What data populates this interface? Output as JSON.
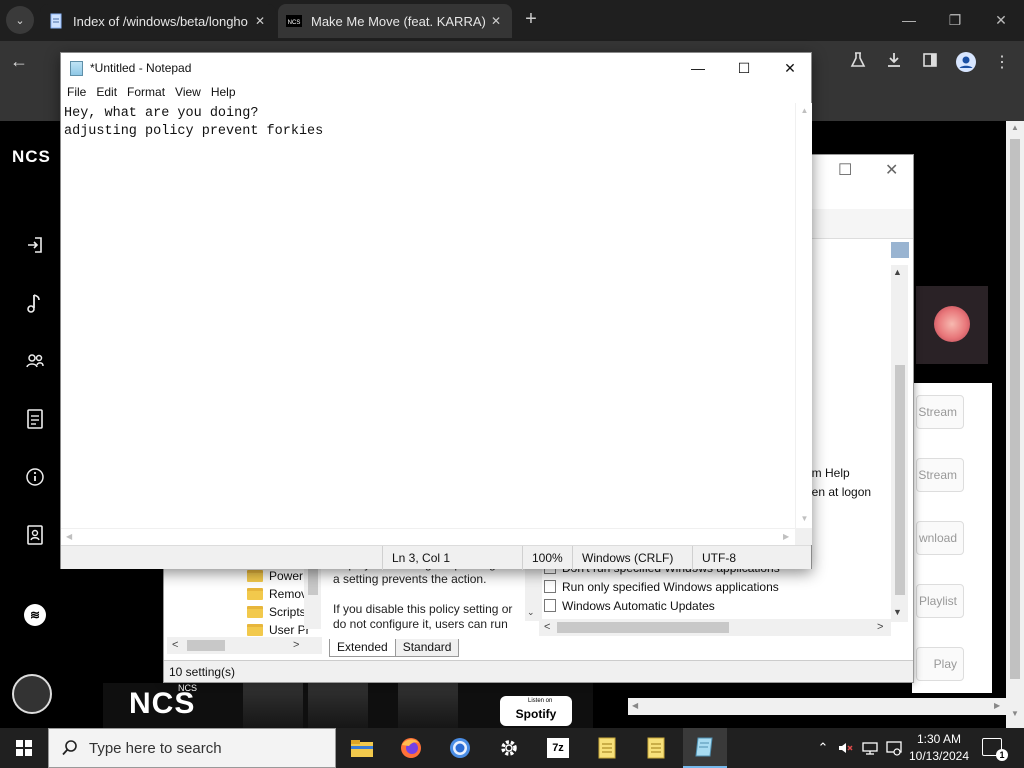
{
  "browser": {
    "tabs": [
      {
        "title": "Index of /windows/beta/longho",
        "close": "✕"
      },
      {
        "title": "Make Me Move (feat. KARRA) [",
        "close": "✕"
      }
    ],
    "new_tab": "+",
    "window_controls": {
      "minimize": "—",
      "maximize": "❐",
      "close": "✕"
    }
  },
  "ncs": {
    "logo": "NCS",
    "banner_text": "NCS",
    "banner_sub": "NCS",
    "spotify_listen": "Listen on",
    "spotify_label": "Spotify",
    "side_buttons": [
      "Stream",
      "Stream",
      "wnload",
      "Playlist",
      "Play"
    ]
  },
  "gpe": {
    "tree_items": [
      "Power",
      "Remov",
      "Scripts",
      "User Pr"
    ],
    "description": "displays a message explaining that a setting prevents the action.\n\nIf you disable this policy setting or do not configure it, users can run",
    "list_items": [
      "Don't run specified Windows applications",
      "Run only specified Windows applications",
      "Windows Automatic Updates"
    ],
    "right_texts": [
      "om Help",
      "een at logon"
    ],
    "tabs": [
      "Extended",
      "Standard"
    ],
    "status": "10 setting(s)"
  },
  "notepad": {
    "title": "*Untitled - Notepad",
    "menu": [
      "File",
      "Edit",
      "Format",
      "View",
      "Help"
    ],
    "content": "Hey, what are you doing?\nadjusting policy prevent forkies",
    "status": {
      "position": "Ln 3, Col 1",
      "zoom": "100%",
      "line_ending": "Windows (CRLF)",
      "encoding": "UTF-8"
    },
    "controls": {
      "minimize": "—",
      "maximize": "☐",
      "close": "✕"
    }
  },
  "taskbar": {
    "search_placeholder": "Type here to search",
    "apps": [
      "file-explorer",
      "firefox",
      "chrome",
      "settings",
      "7zip",
      "notepad-1",
      "notepad-2",
      "notepad-active"
    ],
    "seven_zip_label": "7z",
    "clock_time": "1:30 AM",
    "clock_date": "10/13/2024",
    "notification_count": "1"
  },
  "colors": {
    "accent": "#76b9ed",
    "selection": "#99b4d1",
    "browser_dark": "#353535"
  }
}
